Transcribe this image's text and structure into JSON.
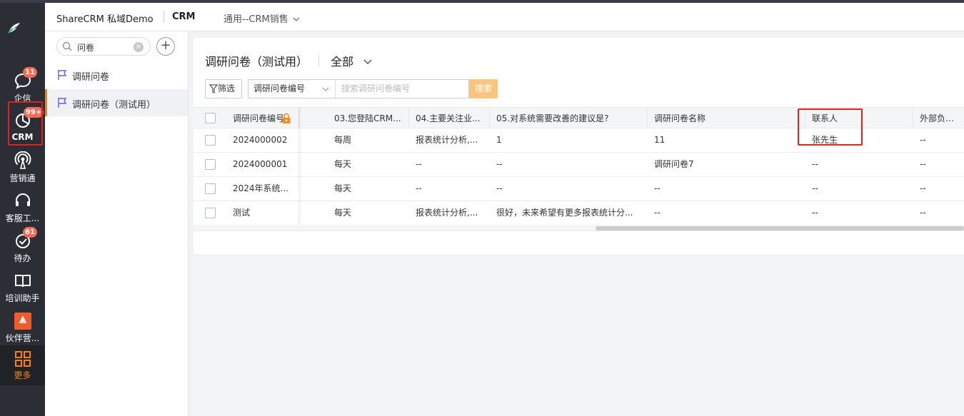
{
  "header": {
    "brand": "ShareCRM 私域Demo",
    "app": "CRM",
    "scope": "通用--CRM销售"
  },
  "rail": [
    {
      "icon": "chat-bubble-icon",
      "label": "企信",
      "badge": "11"
    },
    {
      "icon": "pie-chart-icon",
      "label": "CRM",
      "badge": "99+"
    },
    {
      "icon": "broadcast-icon",
      "label": "营销通",
      "badge": ""
    },
    {
      "icon": "headset-icon",
      "label": "客服工...",
      "badge": ""
    },
    {
      "icon": "check-circle-icon",
      "label": "待办",
      "badge": "61"
    },
    {
      "icon": "book-icon",
      "label": "培训助手",
      "badge": ""
    },
    {
      "icon": "partner-app-icon",
      "label": "伙伴营...",
      "badge": ""
    },
    {
      "icon": "grid-icon",
      "label": "更多",
      "badge": ""
    }
  ],
  "objects": {
    "search_value": "问卷",
    "items": [
      {
        "label": "调研问卷"
      },
      {
        "label": "调研问卷（测试用）"
      }
    ]
  },
  "main": {
    "title": "调研问卷（测试用）",
    "scope_filter": "全部",
    "filter_label": "筛选",
    "field_select": "调研问卷编号",
    "search_placeholder": "搜索调研问卷编号",
    "search_button": "搜索",
    "columns": [
      "调研问卷编号",
      "03.您登陆CRM...",
      "04.主要关注业...",
      "05.对系统需要改善的建议是?",
      "调研问卷名称",
      "联系人",
      "外部负责人"
    ],
    "rows": [
      [
        "2024000002",
        "每周",
        "报表统计分析,...",
        "1",
        "11",
        "张先生",
        "--"
      ],
      [
        "2024000001",
        "每天",
        "--",
        "--",
        "调研问卷7",
        "--",
        "--"
      ],
      [
        "2024年系统...",
        "每天",
        "--",
        "--",
        "--",
        "--",
        "--"
      ],
      [
        "测试",
        "每天",
        "报表统计分析,...",
        "很好，未来希望有更多报表统计分...",
        "--",
        "--",
        "--"
      ]
    ]
  },
  "colors": {
    "accent": "#ff8000",
    "link": "#1a6ed8",
    "highlight_box": "#e0201c",
    "rail_bg": "#2b2e35"
  }
}
